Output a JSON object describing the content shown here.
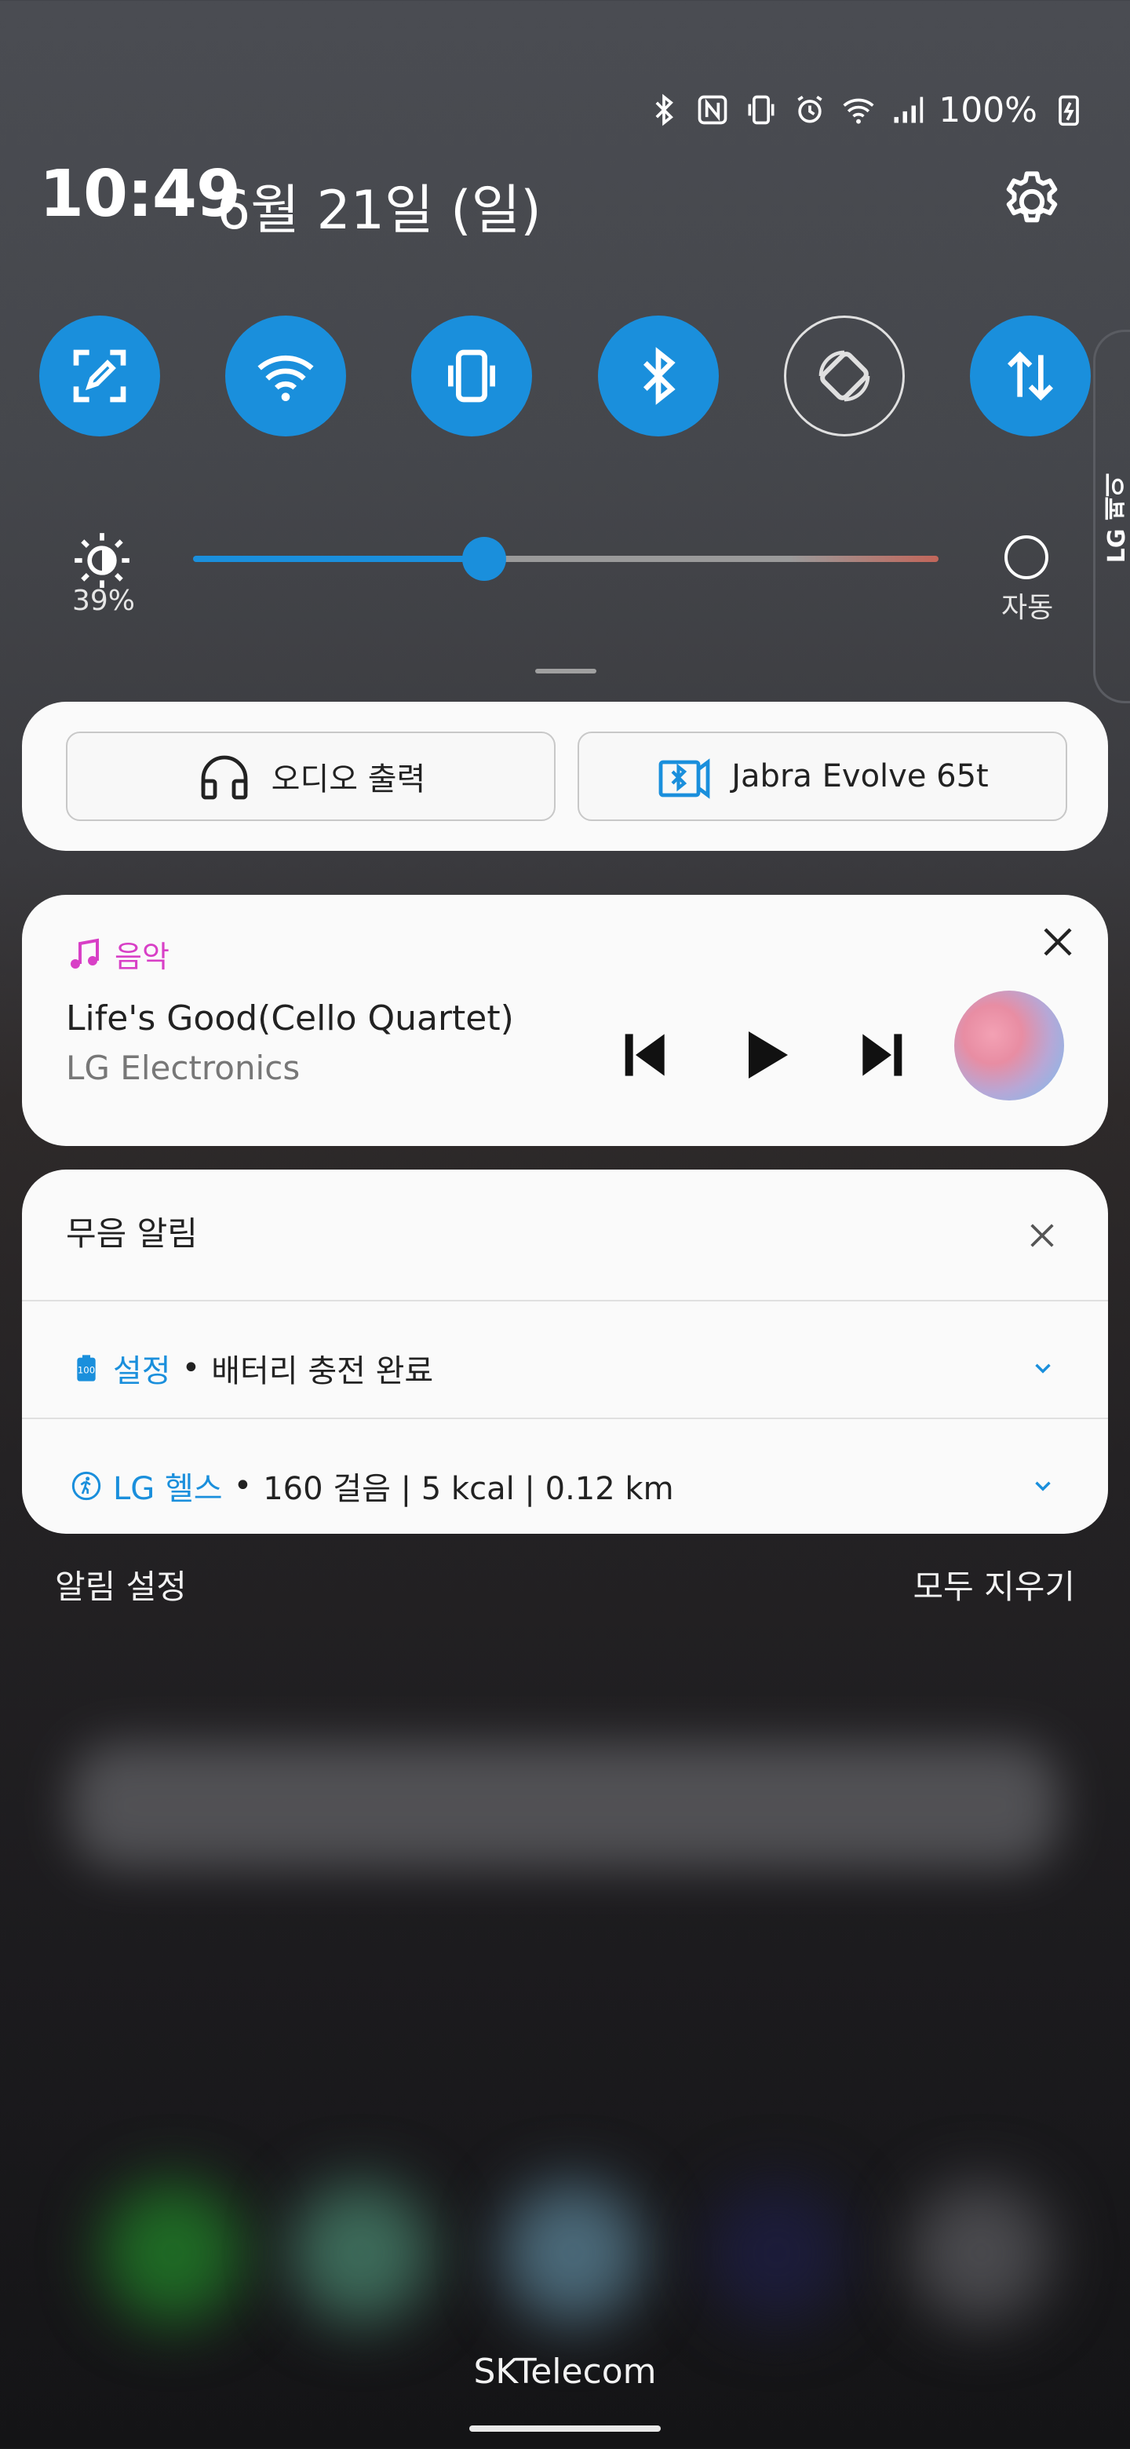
{
  "status_bar": {
    "battery_text": "100%",
    "icons": [
      "bluetooth-icon",
      "nfc-icon",
      "vibrate-icon",
      "alarm-icon",
      "wifi-icon",
      "signal-icon",
      "battery-charging-icon"
    ]
  },
  "header": {
    "time": "10:49",
    "date": "6월 21일 (일)",
    "settings_icon": "gear-icon"
  },
  "quick_toggles": [
    {
      "name": "screen-capture",
      "icon": "capture-icon",
      "on": true
    },
    {
      "name": "wifi",
      "icon": "wifi-icon",
      "on": true
    },
    {
      "name": "vibrate",
      "icon": "vibrate-icon",
      "on": true
    },
    {
      "name": "bluetooth",
      "icon": "bluetooth-icon",
      "on": true
    },
    {
      "name": "auto-rotate",
      "icon": "rotate-icon",
      "on": false
    },
    {
      "name": "mobile-data",
      "icon": "data-arrows-icon",
      "on": true
    }
  ],
  "side_tab": {
    "label": "LG 페이"
  },
  "brightness": {
    "percent_label": "39%",
    "value": 0.39,
    "auto_label": "자동"
  },
  "audio_card": {
    "output_label": "오디오 출력",
    "device_label": "Jabra Evolve 65t"
  },
  "music_card": {
    "app_name": "음악",
    "title": "Life's Good(Cello Quartet)",
    "artist": "LG Electronics"
  },
  "silent_card": {
    "header": "무음 알림",
    "notifications": [
      {
        "app": "설정",
        "text": "배터리 충전 완료"
      },
      {
        "app": "LG 헬스",
        "text": "160 걸음 | 5 kcal | 0.12 km"
      }
    ]
  },
  "footer": {
    "settings_label": "알림 설정",
    "clear_all_label": "모두 지우기"
  },
  "carrier": "SKTelecom",
  "colors": {
    "accent": "#1a8fdc",
    "music_accent": "#d83fc6"
  }
}
